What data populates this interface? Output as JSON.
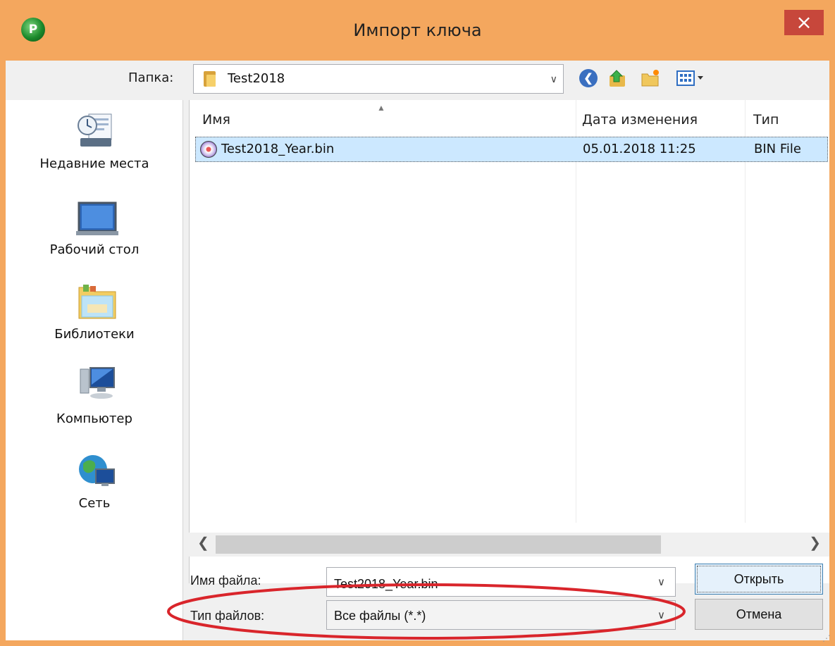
{
  "window": {
    "title": "Импорт ключа",
    "close_label": "×",
    "app_icon_letter": "P"
  },
  "toolbar": {
    "look_in_label": "Папка:",
    "current_folder": "Test2018",
    "icons": [
      "back-icon",
      "up-folder-icon",
      "new-folder-icon",
      "view-menu-icon"
    ]
  },
  "sidebar": {
    "items": [
      {
        "label": "Недавние места",
        "icon": "recent-places-icon"
      },
      {
        "label": "Рабочий стол",
        "icon": "desktop-icon"
      },
      {
        "label": "Библиотеки",
        "icon": "libraries-icon"
      },
      {
        "label": "Компьютер",
        "icon": "computer-icon"
      },
      {
        "label": "Сеть",
        "icon": "network-icon"
      }
    ]
  },
  "file_list": {
    "columns": [
      "Имя",
      "Дата изменения",
      "Тип"
    ],
    "sorted_by": "Имя",
    "rows": [
      {
        "name": "Test2018_Year.bin",
        "date": "05.01.2018 11:25",
        "type": "BIN File",
        "selected": true
      }
    ]
  },
  "filename_field": {
    "label": "Имя файла:",
    "value": "Test2018_Year.bin"
  },
  "filetype_field": {
    "label": "Тип файлов:",
    "value": "Все файлы (*.*)"
  },
  "buttons": {
    "open": "Открыть",
    "cancel": "Отмена"
  },
  "colors": {
    "title_bar": "#f4a75e",
    "close_button": "#c7473b",
    "selection": "#cce8ff",
    "annotation": "#d9252b"
  }
}
